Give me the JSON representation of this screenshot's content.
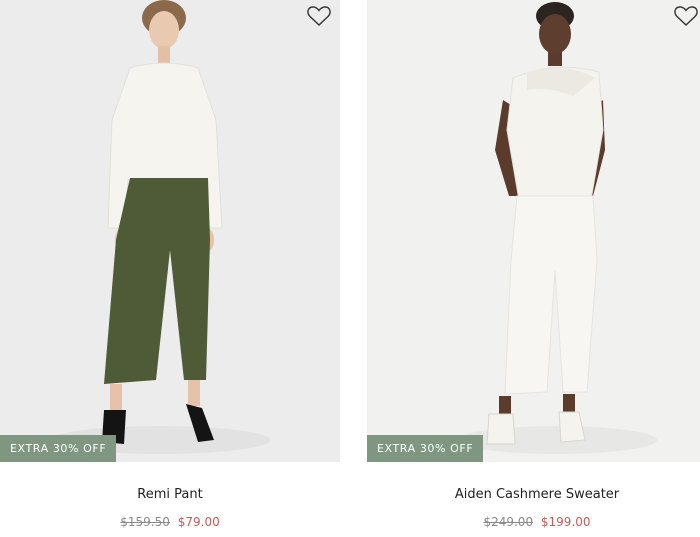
{
  "products": [
    {
      "name": "Remi Pant",
      "original_price": "$159.50",
      "sale_price": "$79.00",
      "badge": "EXTRA 30% OFF",
      "wishlist_icon": "heart-outline-icon"
    },
    {
      "name": "Aiden Cashmere Sweater",
      "original_price": "$249.00",
      "sale_price": "$199.00",
      "badge": "EXTRA 30% OFF",
      "wishlist_icon": "heart-outline-icon"
    }
  ],
  "colors": {
    "badge_bg": "#7f9680",
    "sale_price": "#c25c5c",
    "original_price": "#8a8a8a"
  }
}
